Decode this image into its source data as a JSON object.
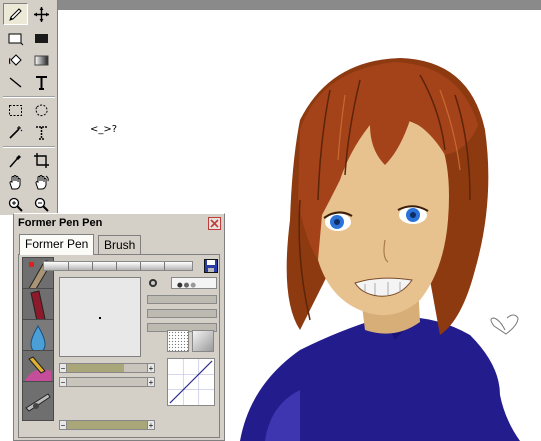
{
  "canvas": {
    "note_text": "<_>?"
  },
  "toolbox": {
    "tools": [
      {
        "icon": "pen-icon",
        "active": true
      },
      {
        "icon": "move-icon"
      },
      {
        "icon": "rect-outline-icon"
      },
      {
        "icon": "rect-fill-icon"
      },
      {
        "icon": "bucket-icon"
      },
      {
        "icon": "gradient-icon"
      },
      {
        "icon": "line-icon"
      },
      {
        "icon": "text-icon"
      },
      {
        "icon": "rect-select-icon"
      },
      {
        "icon": "lasso-icon"
      },
      {
        "icon": "magic-wand-icon"
      },
      {
        "icon": "text-select-icon"
      },
      {
        "icon": "eyedropper-icon"
      },
      {
        "icon": "crop-icon"
      },
      {
        "icon": "hand-icon"
      },
      {
        "icon": "rotate-hand-icon"
      },
      {
        "icon": "zoom-in-icon"
      },
      {
        "icon": "zoom-out-icon"
      }
    ]
  },
  "panel": {
    "title": "Former Pen  Pen",
    "tabs": [
      {
        "label": "Former Pen",
        "active": true
      },
      {
        "label": "Brush",
        "active": false
      }
    ],
    "brushes": [
      "pen-brush",
      "marker-brush",
      "water-drop-brush",
      "paint-brush",
      "airbrush-brush"
    ],
    "sliders": [
      {
        "name": "density-slider",
        "value": 0.68
      },
      {
        "name": "blend-slider",
        "value": 0.05
      },
      {
        "name": "texture-slider",
        "value": 0.97
      }
    ]
  },
  "colors": {
    "panel_bg": "#d4d0c8",
    "hair": "#9a3a12",
    "skin": "#e7c28e",
    "shirt": "#231c8c",
    "eyes": "#2a72d8"
  }
}
